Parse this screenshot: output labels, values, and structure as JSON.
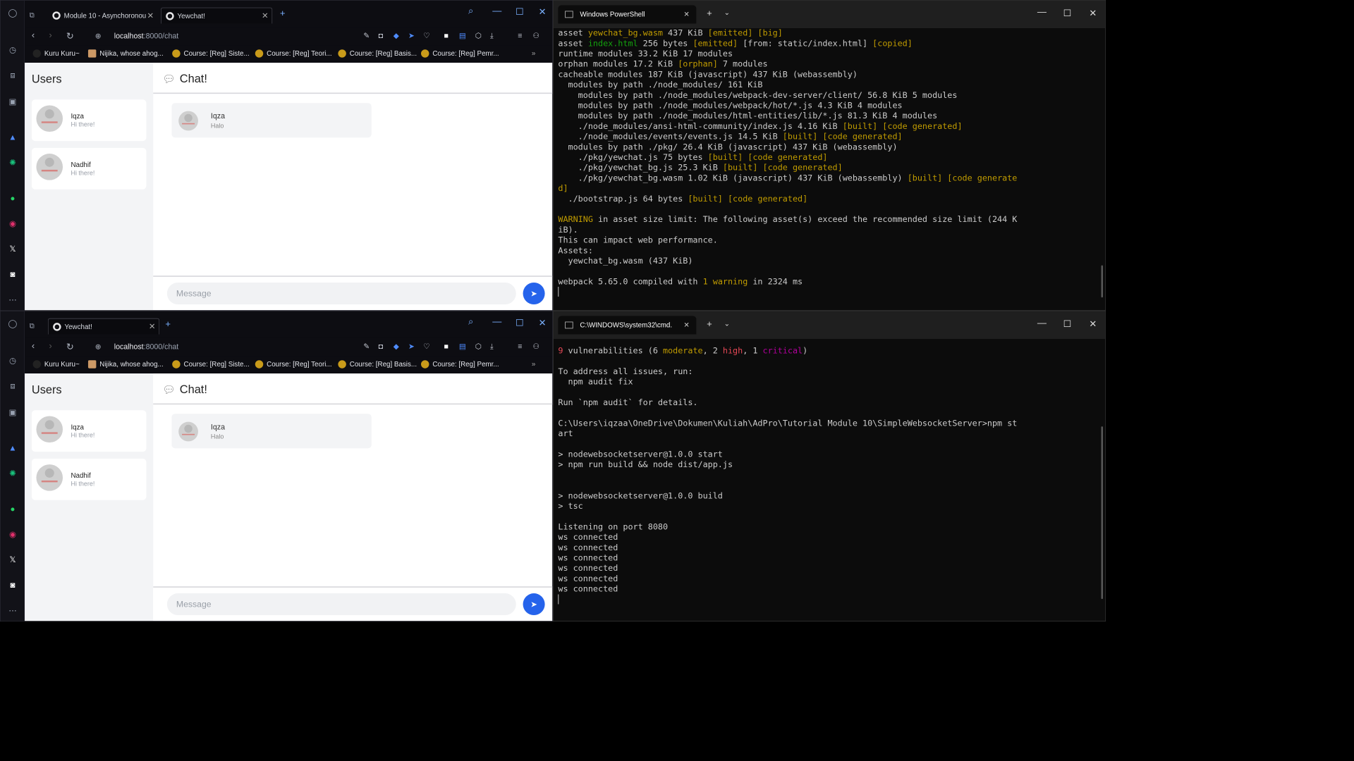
{
  "browser": {
    "url_host": "localhost",
    "url_path": ":8000/chat",
    "tab_top_1": "Module 10 - Asynchoronou",
    "tab_active": "Yewchat!",
    "bookmarks": [
      "Kuru Kuru~",
      "Nijika, whose ahog...",
      "Course: [Reg] Siste...",
      "Course: [Reg] Teori...",
      "Course: [Reg] Basis...",
      "Course: [Reg] Pemr..."
    ]
  },
  "app": {
    "users_title": "Users",
    "chat_title": "Chat!",
    "users": [
      {
        "name": "Iqza",
        "status": "Hi there!"
      },
      {
        "name": "Nadhif",
        "status": "Hi there!"
      }
    ],
    "message": {
      "name": "Iqza",
      "text": "Halo"
    },
    "input_placeholder": "Message"
  },
  "terminal_top": {
    "tab": "Windows PowerShell",
    "lines": [
      [
        [
          "w",
          "asset "
        ],
        [
          "y",
          "yewchat_bg.wasm"
        ],
        [
          "w",
          " 437 KiB "
        ],
        [
          "y",
          "[emitted] [big]"
        ]
      ],
      [
        [
          "w",
          "asset "
        ],
        [
          "g",
          "index.html"
        ],
        [
          "w",
          " 256 bytes "
        ],
        [
          "y",
          "[emitted]"
        ],
        [
          "w",
          " [from: static/index.html] "
        ],
        [
          "y",
          "[copied]"
        ]
      ],
      [
        [
          "w",
          "runtime modules 33.2 KiB 17 modules"
        ]
      ],
      [
        [
          "w",
          "orphan modules 17.2 KiB "
        ],
        [
          "y",
          "[orphan]"
        ],
        [
          "w",
          " 7 modules"
        ]
      ],
      [
        [
          "w",
          "cacheable modules 187 KiB (javascript) 437 KiB (webassembly)"
        ]
      ],
      [
        [
          "w",
          "  modules by path ./node_modules/ 161 KiB"
        ]
      ],
      [
        [
          "w",
          "    modules by path ./node_modules/webpack-dev-server/client/ 56.8 KiB 5 modules"
        ]
      ],
      [
        [
          "w",
          "    modules by path ./node_modules/webpack/hot/*.js 4.3 KiB 4 modules"
        ]
      ],
      [
        [
          "w",
          "    modules by path ./node_modules/html-entities/lib/*.js 81.3 KiB 4 modules"
        ]
      ],
      [
        [
          "w",
          "    ./node_modules/ansi-html-community/index.js 4.16 KiB "
        ],
        [
          "y",
          "[built] [code generated]"
        ]
      ],
      [
        [
          "w",
          "    ./node_modules/events/events.js 14.5 KiB "
        ],
        [
          "y",
          "[built] [code generated]"
        ]
      ],
      [
        [
          "w",
          "  modules by path ./pkg/ 26.4 KiB (javascript) 437 KiB (webassembly)"
        ]
      ],
      [
        [
          "w",
          "    ./pkg/yewchat.js 75 bytes "
        ],
        [
          "y",
          "[built] [code generated]"
        ]
      ],
      [
        [
          "w",
          "    ./pkg/yewchat_bg.js 25.3 KiB "
        ],
        [
          "y",
          "[built] [code generated]"
        ]
      ],
      [
        [
          "w",
          "    ./pkg/yewchat_bg.wasm 1.02 KiB (javascript) 437 KiB (webassembly) "
        ],
        [
          "y",
          "[built] [code generate"
        ]
      ],
      [
        [
          "y",
          "d]"
        ]
      ],
      [
        [
          "w",
          "  ./bootstrap.js 64 bytes "
        ],
        [
          "y",
          "[built] [code generated]"
        ]
      ],
      [
        [
          "w",
          ""
        ]
      ],
      [
        [
          "y",
          "WARNING"
        ],
        [
          "w",
          " in asset size limit: The following asset(s) exceed the recommended size limit (244 K"
        ]
      ],
      [
        [
          "w",
          "iB)."
        ]
      ],
      [
        [
          "w",
          "This can impact web performance."
        ]
      ],
      [
        [
          "w",
          "Assets:"
        ]
      ],
      [
        [
          "w",
          "  yewchat_bg.wasm (437 KiB)"
        ]
      ],
      [
        [
          "w",
          ""
        ]
      ],
      [
        [
          "w",
          "webpack 5.65.0 compiled with "
        ],
        [
          "y",
          "1 warning"
        ],
        [
          "w",
          " in 2324 ms"
        ]
      ],
      [
        [
          "w",
          "▏"
        ]
      ]
    ]
  },
  "terminal_bottom": {
    "tab": "C:\\WINDOWS\\system32\\cmd.",
    "lines": [
      [
        [
          "r",
          "9"
        ],
        [
          "w",
          " vulnerabilities (6 "
        ],
        [
          "y",
          "moderate"
        ],
        [
          "w",
          ", 2 "
        ],
        [
          "r",
          "high"
        ],
        [
          "w",
          ", 1 "
        ],
        [
          "m",
          "critical"
        ],
        [
          "w",
          ")"
        ]
      ],
      [
        [
          "w",
          ""
        ]
      ],
      [
        [
          "w",
          "To address all issues, run:"
        ]
      ],
      [
        [
          "w",
          "  npm audit fix"
        ]
      ],
      [
        [
          "w",
          ""
        ]
      ],
      [
        [
          "w",
          "Run `npm audit` for details."
        ]
      ],
      [
        [
          "w",
          ""
        ]
      ],
      [
        [
          "w",
          "C:\\Users\\iqzaa\\OneDrive\\Dokumen\\Kuliah\\AdPro\\Tutorial Module 10\\SimpleWebsocketServer>npm st"
        ]
      ],
      [
        [
          "w",
          "art"
        ]
      ],
      [
        [
          "w",
          ""
        ]
      ],
      [
        [
          "w",
          "> nodewebsocketserver@1.0.0 start"
        ]
      ],
      [
        [
          "w",
          "> npm run build && node dist/app.js"
        ]
      ],
      [
        [
          "w",
          ""
        ]
      ],
      [
        [
          "w",
          ""
        ]
      ],
      [
        [
          "w",
          "> nodewebsocketserver@1.0.0 build"
        ]
      ],
      [
        [
          "w",
          "> tsc"
        ]
      ],
      [
        [
          "w",
          ""
        ]
      ],
      [
        [
          "w",
          "Listening on port 8080"
        ]
      ],
      [
        [
          "w",
          "ws connected"
        ]
      ],
      [
        [
          "w",
          "ws connected"
        ]
      ],
      [
        [
          "w",
          "ws connected"
        ]
      ],
      [
        [
          "w",
          "ws connected"
        ]
      ],
      [
        [
          "w",
          "ws connected"
        ]
      ],
      [
        [
          "w",
          "ws connected"
        ]
      ],
      [
        [
          "w",
          "▏"
        ]
      ]
    ]
  },
  "icons": [
    "opera-icon",
    "speed-dial-icon",
    "bag-icon",
    "extensions-icon",
    "aria-icon",
    "chatgpt-icon",
    "whatsapp-icon",
    "instagram-icon",
    "x-icon",
    "discord-icon",
    "more-icon",
    "search-icon",
    "minimize-icon",
    "maximize-icon",
    "close-icon",
    "send-icon",
    "chat-bubble-icon"
  ]
}
